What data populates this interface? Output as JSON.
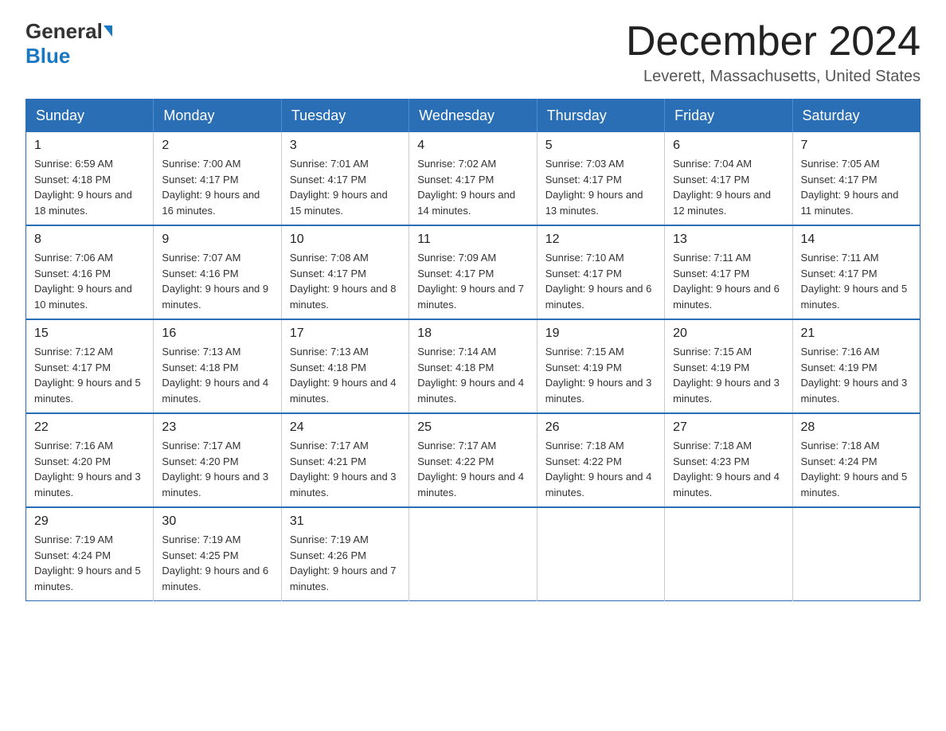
{
  "header": {
    "logo_general": "General",
    "logo_blue": "Blue",
    "month_title": "December 2024",
    "location": "Leverett, Massachusetts, United States"
  },
  "weekdays": [
    "Sunday",
    "Monday",
    "Tuesday",
    "Wednesday",
    "Thursday",
    "Friday",
    "Saturday"
  ],
  "weeks": [
    [
      {
        "day": "1",
        "sunrise": "6:59 AM",
        "sunset": "4:18 PM",
        "daylight": "9 hours and 18 minutes."
      },
      {
        "day": "2",
        "sunrise": "7:00 AM",
        "sunset": "4:17 PM",
        "daylight": "9 hours and 16 minutes."
      },
      {
        "day": "3",
        "sunrise": "7:01 AM",
        "sunset": "4:17 PM",
        "daylight": "9 hours and 15 minutes."
      },
      {
        "day": "4",
        "sunrise": "7:02 AM",
        "sunset": "4:17 PM",
        "daylight": "9 hours and 14 minutes."
      },
      {
        "day": "5",
        "sunrise": "7:03 AM",
        "sunset": "4:17 PM",
        "daylight": "9 hours and 13 minutes."
      },
      {
        "day": "6",
        "sunrise": "7:04 AM",
        "sunset": "4:17 PM",
        "daylight": "9 hours and 12 minutes."
      },
      {
        "day": "7",
        "sunrise": "7:05 AM",
        "sunset": "4:17 PM",
        "daylight": "9 hours and 11 minutes."
      }
    ],
    [
      {
        "day": "8",
        "sunrise": "7:06 AM",
        "sunset": "4:16 PM",
        "daylight": "9 hours and 10 minutes."
      },
      {
        "day": "9",
        "sunrise": "7:07 AM",
        "sunset": "4:16 PM",
        "daylight": "9 hours and 9 minutes."
      },
      {
        "day": "10",
        "sunrise": "7:08 AM",
        "sunset": "4:17 PM",
        "daylight": "9 hours and 8 minutes."
      },
      {
        "day": "11",
        "sunrise": "7:09 AM",
        "sunset": "4:17 PM",
        "daylight": "9 hours and 7 minutes."
      },
      {
        "day": "12",
        "sunrise": "7:10 AM",
        "sunset": "4:17 PM",
        "daylight": "9 hours and 6 minutes."
      },
      {
        "day": "13",
        "sunrise": "7:11 AM",
        "sunset": "4:17 PM",
        "daylight": "9 hours and 6 minutes."
      },
      {
        "day": "14",
        "sunrise": "7:11 AM",
        "sunset": "4:17 PM",
        "daylight": "9 hours and 5 minutes."
      }
    ],
    [
      {
        "day": "15",
        "sunrise": "7:12 AM",
        "sunset": "4:17 PM",
        "daylight": "9 hours and 5 minutes."
      },
      {
        "day": "16",
        "sunrise": "7:13 AM",
        "sunset": "4:18 PM",
        "daylight": "9 hours and 4 minutes."
      },
      {
        "day": "17",
        "sunrise": "7:13 AM",
        "sunset": "4:18 PM",
        "daylight": "9 hours and 4 minutes."
      },
      {
        "day": "18",
        "sunrise": "7:14 AM",
        "sunset": "4:18 PM",
        "daylight": "9 hours and 4 minutes."
      },
      {
        "day": "19",
        "sunrise": "7:15 AM",
        "sunset": "4:19 PM",
        "daylight": "9 hours and 3 minutes."
      },
      {
        "day": "20",
        "sunrise": "7:15 AM",
        "sunset": "4:19 PM",
        "daylight": "9 hours and 3 minutes."
      },
      {
        "day": "21",
        "sunrise": "7:16 AM",
        "sunset": "4:19 PM",
        "daylight": "9 hours and 3 minutes."
      }
    ],
    [
      {
        "day": "22",
        "sunrise": "7:16 AM",
        "sunset": "4:20 PM",
        "daylight": "9 hours and 3 minutes."
      },
      {
        "day": "23",
        "sunrise": "7:17 AM",
        "sunset": "4:20 PM",
        "daylight": "9 hours and 3 minutes."
      },
      {
        "day": "24",
        "sunrise": "7:17 AM",
        "sunset": "4:21 PM",
        "daylight": "9 hours and 3 minutes."
      },
      {
        "day": "25",
        "sunrise": "7:17 AM",
        "sunset": "4:22 PM",
        "daylight": "9 hours and 4 minutes."
      },
      {
        "day": "26",
        "sunrise": "7:18 AM",
        "sunset": "4:22 PM",
        "daylight": "9 hours and 4 minutes."
      },
      {
        "day": "27",
        "sunrise": "7:18 AM",
        "sunset": "4:23 PM",
        "daylight": "9 hours and 4 minutes."
      },
      {
        "day": "28",
        "sunrise": "7:18 AM",
        "sunset": "4:24 PM",
        "daylight": "9 hours and 5 minutes."
      }
    ],
    [
      {
        "day": "29",
        "sunrise": "7:19 AM",
        "sunset": "4:24 PM",
        "daylight": "9 hours and 5 minutes."
      },
      {
        "day": "30",
        "sunrise": "7:19 AM",
        "sunset": "4:25 PM",
        "daylight": "9 hours and 6 minutes."
      },
      {
        "day": "31",
        "sunrise": "7:19 AM",
        "sunset": "4:26 PM",
        "daylight": "9 hours and 7 minutes."
      },
      null,
      null,
      null,
      null
    ]
  ],
  "labels": {
    "sunrise_prefix": "Sunrise: ",
    "sunset_prefix": "Sunset: ",
    "daylight_prefix": "Daylight: "
  }
}
